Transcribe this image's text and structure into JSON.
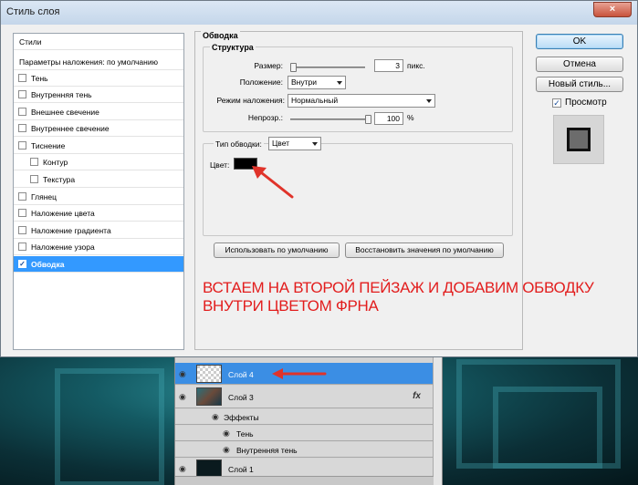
{
  "window": {
    "title": "Стиль слоя",
    "close_glyph": "×"
  },
  "styles_list": {
    "header1": "Стили",
    "header2": "Параметры наложения: по умолчанию",
    "items": [
      {
        "label": "Тень",
        "checked": false,
        "indent": false
      },
      {
        "label": "Внутренняя тень",
        "checked": false,
        "indent": false
      },
      {
        "label": "Внешнее свечение",
        "checked": false,
        "indent": false
      },
      {
        "label": "Внутреннее свечение",
        "checked": false,
        "indent": false
      },
      {
        "label": "Тиснение",
        "checked": false,
        "indent": false
      },
      {
        "label": "Контур",
        "checked": false,
        "indent": true
      },
      {
        "label": "Текстура",
        "checked": false,
        "indent": true
      },
      {
        "label": "Глянец",
        "checked": false,
        "indent": false
      },
      {
        "label": "Наложение цвета",
        "checked": false,
        "indent": false
      },
      {
        "label": "Наложение градиента",
        "checked": false,
        "indent": false
      },
      {
        "label": "Наложение узора",
        "checked": false,
        "indent": false
      },
      {
        "label": "Обводка",
        "checked": true,
        "indent": false,
        "selected": true
      }
    ]
  },
  "stroke": {
    "section_title": "Обводка",
    "structure_title": "Структура",
    "size_label": "Размер:",
    "size_value": "3",
    "size_unit": "пикс.",
    "position_label": "Положение:",
    "position_value": "Внутри",
    "blend_label": "Режим наложения:",
    "blend_value": "Нормальный",
    "opacity_label": "Непрозр.:",
    "opacity_value": "100",
    "opacity_unit": "%",
    "fill_type_label": "Тип обводки:",
    "fill_type_value": "Цвет",
    "color_label": "Цвет:",
    "color_value": "#000000",
    "default_button": "Использовать по умолчанию",
    "reset_button": "Восстановить значения по умолчанию"
  },
  "annotation": "ВСТАЕМ НА ВТОРОЙ ПЕЙЗАЖ И ДОБАВИМ ОБВОДКУ ВНУТРИ ЦВЕТОМ ФРНА",
  "right_buttons": {
    "ok": "OK",
    "cancel": "Отмена",
    "new_style": "Новый стиль...",
    "preview_label": "Просмотр",
    "preview_checked": true
  },
  "layers": {
    "rows": [
      {
        "name": "Слой 4",
        "selected": true
      },
      {
        "name": "Слой 3",
        "selected": false,
        "fx": "fx"
      },
      {
        "name": "Эффекты"
      },
      {
        "name": "Тень"
      },
      {
        "name": "Внутренняя тень"
      },
      {
        "name": "Слой 1",
        "selected": false
      }
    ]
  },
  "colors": {
    "accent": "#3399ff",
    "annotation_red": "#e21d1d",
    "layer_selected": "#3b8ee4"
  }
}
